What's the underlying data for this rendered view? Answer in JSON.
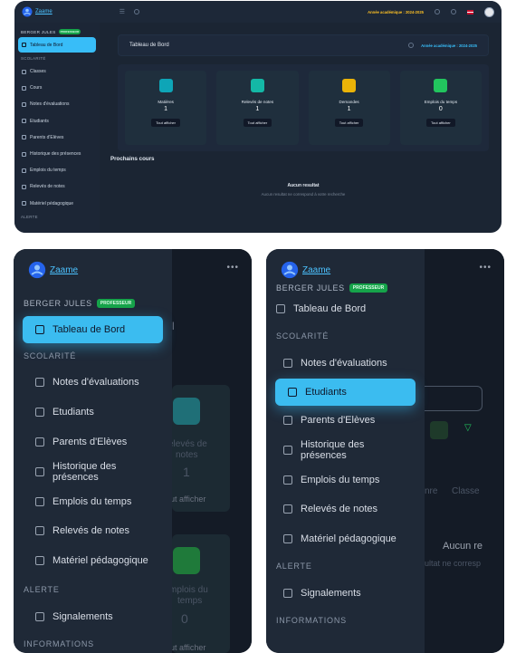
{
  "brand": {
    "name": "Zaame"
  },
  "user": {
    "name": "BERGER JULES",
    "role": "PROFESSEUR"
  },
  "desktop": {
    "academic_year": "Année académique : 2024-2025",
    "page_title": "Tableau de Bord",
    "sections": {
      "scolarite": "SCOLARITÉ",
      "alerte": "ALERTE"
    },
    "nav_active": "Tableau de Bord",
    "nav": [
      "Classes",
      "Cours",
      "Notes d'évaluations",
      "Etudiants",
      "Parents d'Elèves",
      "Historique des présences",
      "Emplois du temps",
      "Relevés de notes",
      "Matériel pédagogique"
    ],
    "cards": [
      {
        "label": "Matières",
        "value": "1",
        "button": "Tout afficher",
        "color": "#0ea5b7"
      },
      {
        "label": "Relevés de notes",
        "value": "1",
        "button": "Tout afficher",
        "color": "#14b8a6"
      },
      {
        "label": "Demandes",
        "value": "1",
        "button": "Tout afficher",
        "color": "#eab308"
      },
      {
        "label": "Emplois du temps",
        "value": "0",
        "button": "Tout afficher",
        "color": "#22c55e"
      }
    ],
    "upcoming_title": "Prochains cours",
    "empty_title": "Aucun resultat",
    "empty_sub": "Aucun resultat ne correspond à votre recherche"
  },
  "mobile1": {
    "sections": {
      "scolarite": "SCOLARITÉ",
      "alerte": "ALERTE",
      "informations": "INFORMATIONS"
    },
    "nav_active": "Tableau de Bord",
    "nav": [
      "Notes d'évaluations",
      "Etudiants",
      "Parents d'Elèves",
      "Historique des présences",
      "Emplois du temps",
      "Relevés de notes",
      "Matériel pédagogique"
    ],
    "alert_item": "Signalements",
    "behind": {
      "label_top": "elevés de",
      "label_mid": "notes",
      "value": "1",
      "button": "ut afficher",
      "label2_top": "mplois du",
      "label2_mid": "temps",
      "value2": "0",
      "button2": "ut afficher"
    }
  },
  "mobile2": {
    "sections": {
      "scolarite": "SCOLARITÉ",
      "alerte": "ALERTE",
      "informations": "INFORMATIONS"
    },
    "nav_top": "Tableau de Bord",
    "nav_before": [
      "Notes d'évaluations"
    ],
    "nav_active": "Etudiants",
    "nav_after": [
      "Parents d'Elèves",
      "Historique des présences",
      "Emplois du temps",
      "Relevés de notes",
      "Matériel pédagogique"
    ],
    "alert_item": "Signalements",
    "behind": {
      "col1": "nre",
      "col2": "Classe",
      "empty_title": "Aucun re",
      "empty_sub": "ultat ne corresp"
    }
  }
}
